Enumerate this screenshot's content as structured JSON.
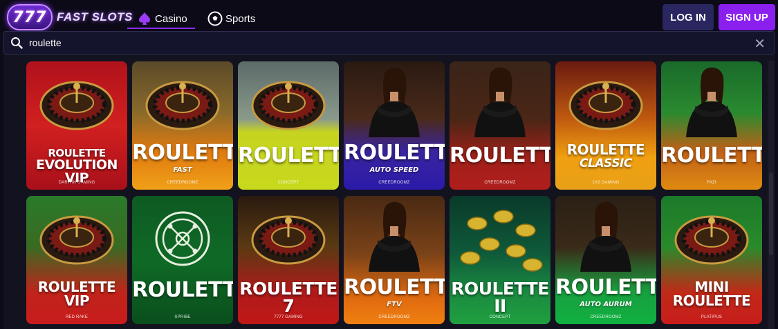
{
  "brand": {
    "badge": "777",
    "name": "FAST SLOTS"
  },
  "nav": {
    "tabs": [
      {
        "label": "Casino",
        "icon": "spade-icon"
      },
      {
        "label": "Sports",
        "icon": "soccer-ball-icon"
      }
    ]
  },
  "auth": {
    "login": "LOG IN",
    "signup": "SIGN UP"
  },
  "search": {
    "value": "roulette"
  },
  "colors": {
    "accent": "#8a1ff0",
    "login_bg": "#2a2660",
    "page_bg": "#0d0b1a"
  },
  "games": [
    {
      "title": "ROULETTE",
      "title2": "EVOLUTION VIP",
      "subtitle": "",
      "provider": "Darwin Gaming",
      "theme": "red"
    },
    {
      "title": "ROULETTE",
      "title2": "",
      "subtitle": "FAST",
      "provider": "Creedroomz",
      "theme": "orange"
    },
    {
      "title": "ROULETTE",
      "title2": "",
      "subtitle": "",
      "provider": "Concept",
      "theme": "lime"
    },
    {
      "title": "ROULETTE",
      "title2": "",
      "subtitle": "AUTO SPEED",
      "provider": "Creedroomz",
      "theme": "blue"
    },
    {
      "title": "ROULETTE",
      "title2": "",
      "subtitle": "",
      "provider": "Creedroomz",
      "theme": "darkred"
    },
    {
      "title": "ROULETTE",
      "title2": "CLASSIC",
      "subtitle": "",
      "provider": "1x2 Gaming",
      "theme": "gold"
    },
    {
      "title": "ROULETTE",
      "title2": "",
      "subtitle": "",
      "provider": "Fazi",
      "theme": "greenorange"
    },
    {
      "title": "ROULETTE VIP",
      "title2": "",
      "subtitle": "",
      "provider": "Red Rake",
      "theme": "greenred"
    },
    {
      "title": "ROULETTE",
      "title2": "",
      "subtitle": "",
      "provider": "Spribe",
      "theme": "green"
    },
    {
      "title": "ROULETTE 7",
      "title2": "",
      "subtitle": "",
      "provider": "7777 Gaming",
      "theme": "crimson"
    },
    {
      "title": "ROULETTE",
      "title2": "",
      "subtitle": "FTV",
      "provider": "Creedroomz",
      "theme": "orange2"
    },
    {
      "title": "ROULETTE II",
      "title2": "",
      "subtitle": "",
      "provider": "Concept",
      "theme": "teal"
    },
    {
      "title": "ROULETTE",
      "title2": "",
      "subtitle": "AUTO AURUM",
      "provider": "Creedroomz",
      "theme": "emerald"
    },
    {
      "title": "MINI ROULETTE",
      "title2": "",
      "subtitle": "",
      "provider": "Platipus",
      "theme": "greenred2"
    }
  ]
}
